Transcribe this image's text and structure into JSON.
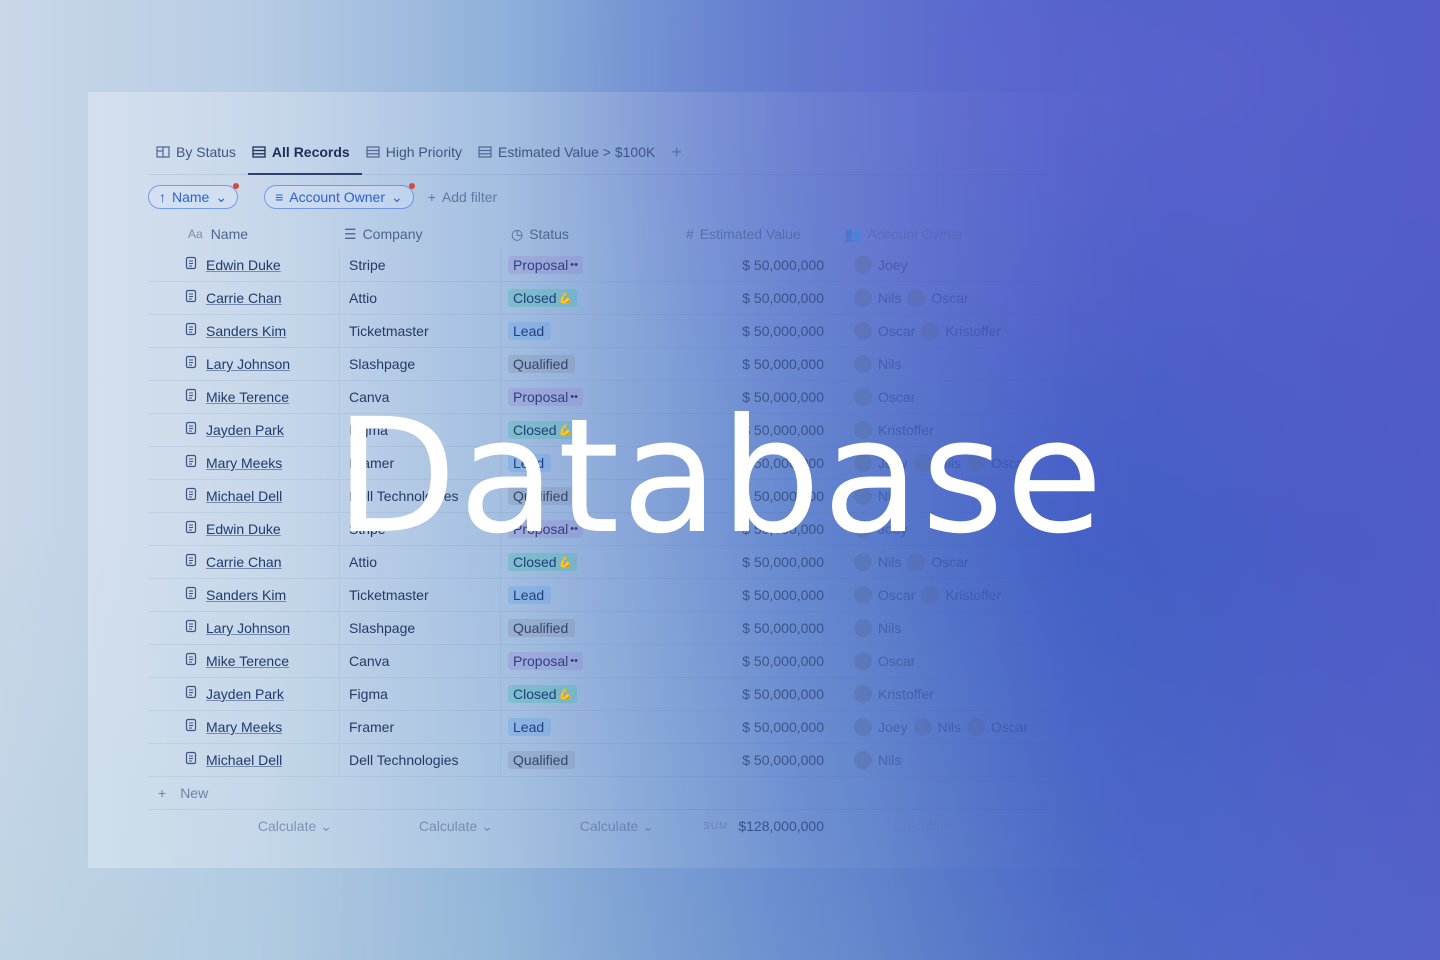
{
  "tabs": [
    {
      "label": "By Status",
      "icon": "board-icon",
      "active": false
    },
    {
      "label": "All Records",
      "icon": "table-icon",
      "active": true
    },
    {
      "label": "High Priority",
      "icon": "table-icon",
      "active": false
    },
    {
      "label": "Estimated Value > $100K",
      "icon": "table-icon",
      "active": false
    }
  ],
  "add_tab_label": "+",
  "filters": {
    "sort_chip": "Name",
    "filter_chip": "Account Owner",
    "add_filter": "Add filter"
  },
  "columns": {
    "name": {
      "icon_text": "Aa",
      "label": "Name"
    },
    "company": {
      "label": "Company"
    },
    "status": {
      "label": "Status"
    },
    "value": {
      "icon_text": "#",
      "label": "Estimated Value"
    },
    "owner": {
      "label": "Account Owner"
    }
  },
  "rows": [
    {
      "name": "Edwin Duke",
      "company": "Stripe",
      "status": "Proposal",
      "status_suffix": "••",
      "status_kind": "proposal",
      "value": "$ 50,000,000",
      "owners": [
        "Joey"
      ]
    },
    {
      "name": "Carrie Chan",
      "company": "Attio",
      "status": "Closed",
      "status_suffix": "💪",
      "status_kind": "closed",
      "value": "$ 50,000,000",
      "owners": [
        "Nils",
        "Oscar"
      ]
    },
    {
      "name": "Sanders Kim",
      "company": "Ticketmaster",
      "status": "Lead",
      "status_suffix": "",
      "status_kind": "lead",
      "value": "$ 50,000,000",
      "owners": [
        "Oscar",
        "Kristoffer"
      ]
    },
    {
      "name": "Lary Johnson",
      "company": "Slashpage",
      "status": "Qualified",
      "status_suffix": "",
      "status_kind": "qualified",
      "value": "$ 50,000,000",
      "owners": [
        "Nils"
      ]
    },
    {
      "name": "Mike Terence",
      "company": "Canva",
      "status": "Proposal",
      "status_suffix": "••",
      "status_kind": "proposal",
      "value": "$ 50,000,000",
      "owners": [
        "Oscar"
      ]
    },
    {
      "name": "Jayden Park",
      "company": "Figma",
      "status": "Closed",
      "status_suffix": "💪",
      "status_kind": "closed",
      "value": "$ 50,000,000",
      "owners": [
        "Kristoffer"
      ]
    },
    {
      "name": "Mary Meeks",
      "company": "Framer",
      "status": "Lead",
      "status_suffix": "",
      "status_kind": "lead",
      "value": "$ 50,000,000",
      "owners": [
        "Joey",
        "Nils",
        "Oscar"
      ]
    },
    {
      "name": "Michael Dell",
      "company": "Dell Technologies",
      "status": "Qualified",
      "status_suffix": "",
      "status_kind": "qualified",
      "value": "$ 50,000,000",
      "owners": [
        "Nils"
      ]
    },
    {
      "name": "Edwin Duke",
      "company": "Stripe",
      "status": "Proposal",
      "status_suffix": "••",
      "status_kind": "proposal",
      "value": "$ 50,000,000",
      "owners": [
        "Joey"
      ]
    },
    {
      "name": "Carrie Chan",
      "company": "Attio",
      "status": "Closed",
      "status_suffix": "💪",
      "status_kind": "closed",
      "value": "$ 50,000,000",
      "owners": [
        "Nils",
        "Oscar"
      ]
    },
    {
      "name": "Sanders Kim",
      "company": "Ticketmaster",
      "status": "Lead",
      "status_suffix": "",
      "status_kind": "lead",
      "value": "$ 50,000,000",
      "owners": [
        "Oscar",
        "Kristoffer"
      ]
    },
    {
      "name": "Lary Johnson",
      "company": "Slashpage",
      "status": "Qualified",
      "status_suffix": "",
      "status_kind": "qualified",
      "value": "$ 50,000,000",
      "owners": [
        "Nils"
      ]
    },
    {
      "name": "Mike Terence",
      "company": "Canva",
      "status": "Proposal",
      "status_suffix": "••",
      "status_kind": "proposal",
      "value": "$ 50,000,000",
      "owners": [
        "Oscar"
      ]
    },
    {
      "name": "Jayden Park",
      "company": "Figma",
      "status": "Closed",
      "status_suffix": "💪",
      "status_kind": "closed",
      "value": "$ 50,000,000",
      "owners": [
        "Kristoffer"
      ]
    },
    {
      "name": "Mary Meeks",
      "company": "Framer",
      "status": "Lead",
      "status_suffix": "",
      "status_kind": "lead",
      "value": "$ 50,000,000",
      "owners": [
        "Joey",
        "Nils",
        "Oscar"
      ]
    },
    {
      "name": "Michael Dell",
      "company": "Dell Technologies",
      "status": "Qualified",
      "status_suffix": "",
      "status_kind": "qualified",
      "value": "$ 50,000,000",
      "owners": [
        "Nils"
      ]
    }
  ],
  "new_row_label": "New",
  "footer": {
    "calculate_label": "Calculate",
    "sum_label": "SUM",
    "sum_value": "$128,000,000",
    "owner_calc_label": "Calculate"
  },
  "hero_title": "Database",
  "colors": {
    "accent": "#2962d9",
    "filter_dot": "#d44a3a",
    "hero_text": "#ffffff"
  }
}
